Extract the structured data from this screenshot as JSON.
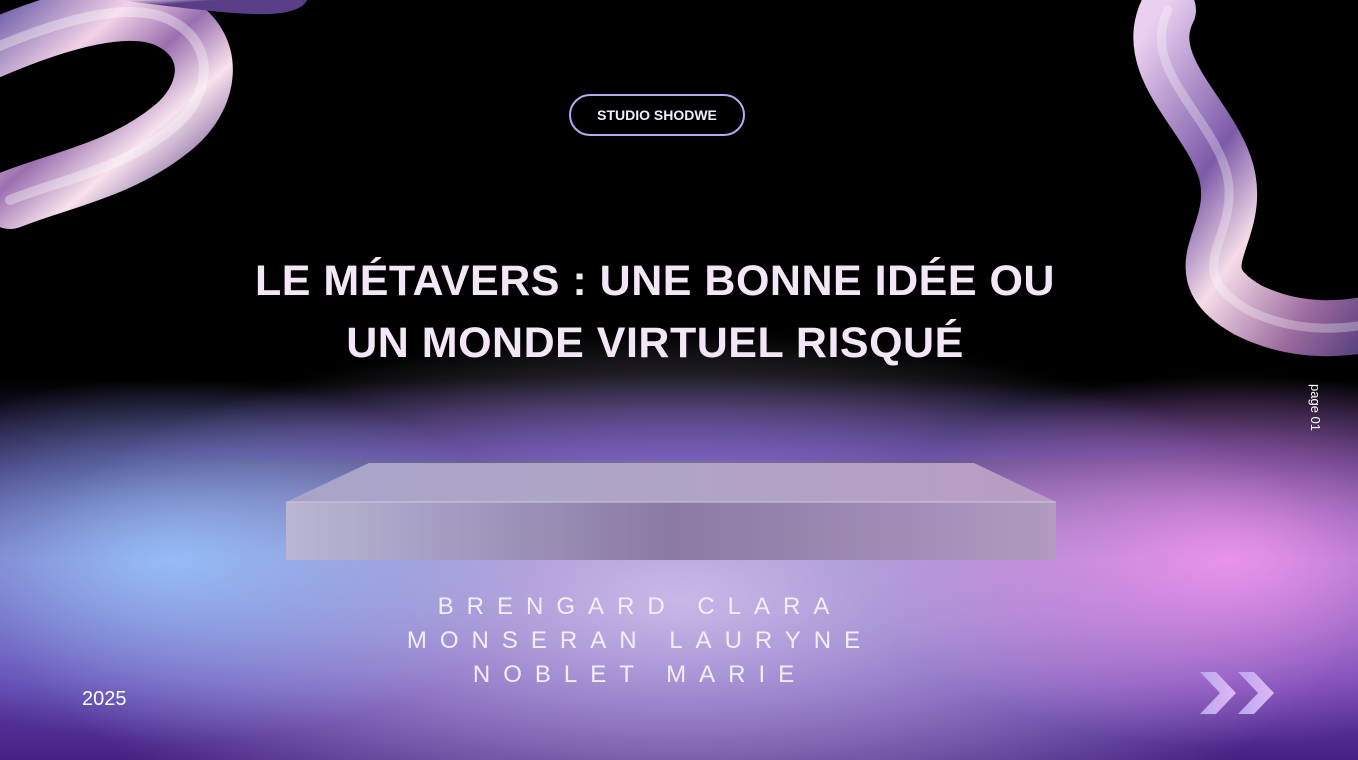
{
  "brand": {
    "label": "STUDIO SHODWE"
  },
  "title": {
    "line1": "LE MÉTAVERS : UNE  BONNE IDÉE OU",
    "line2": "UN MONDE VIRTUEL RISQUÉ"
  },
  "page": {
    "label": "page 01"
  },
  "authors": [
    "BRENGARD CLARA",
    "MONSERAN LAURYNE",
    "NOBLET MARIE"
  ],
  "year": "2025",
  "icons": {
    "next": "double-chevron-right-icon",
    "decor_left": "chrome-wave-icon",
    "decor_right": "chrome-wave-icon"
  },
  "colors": {
    "background": "#000000",
    "title": "#f3e6f7",
    "pill_border": "#b7a9f2",
    "arrow_start": "#b9a6ef",
    "arrow_end": "#e0b8f5"
  }
}
